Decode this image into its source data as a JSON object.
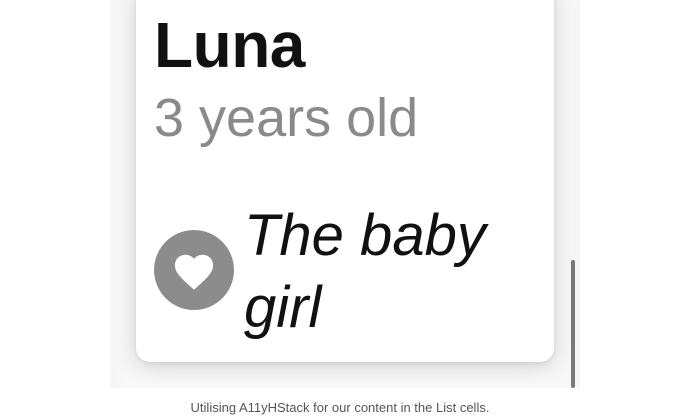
{
  "pet": {
    "name": "Luna",
    "age": "3 years old",
    "nickname": "The baby girl",
    "badge_icon": "heart-icon"
  },
  "caption": "Utilising A11yHStack for our content in the List cells.",
  "colors": {
    "badge_background": "#8c8c8c",
    "name_text": "#111111",
    "age_text": "#8a8a8a"
  }
}
